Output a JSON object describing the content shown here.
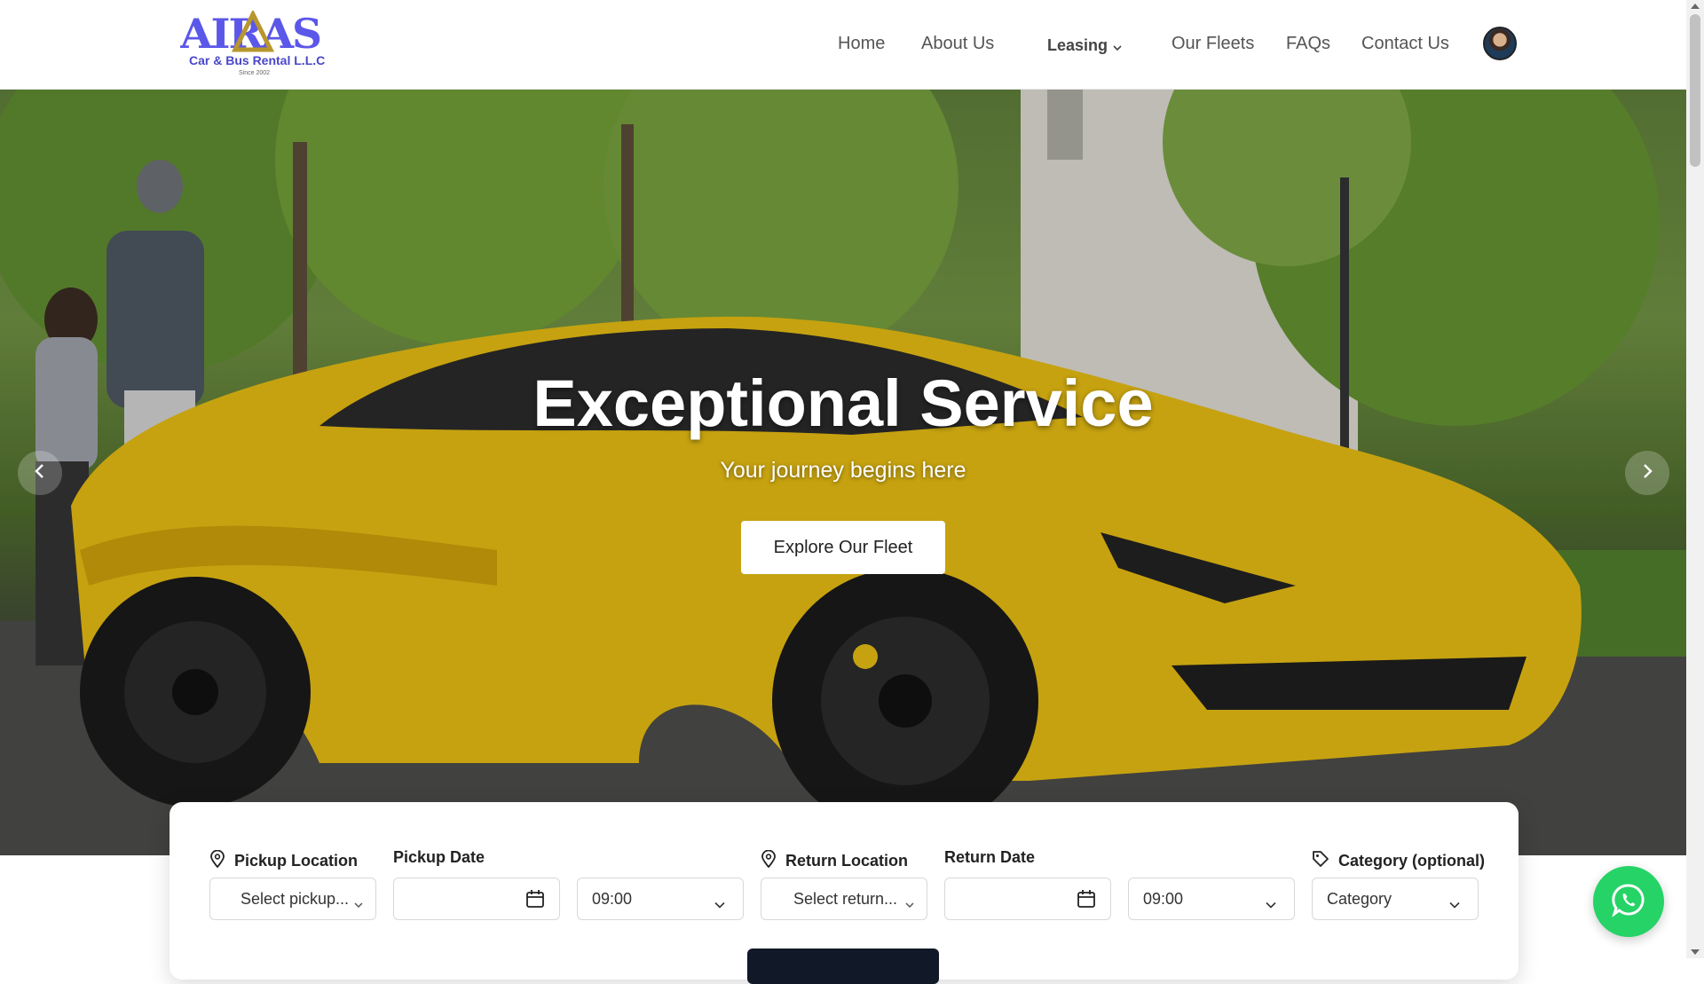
{
  "brand": {
    "name": "AIRAS",
    "tagline": "Car & Bus Rental  L.L.C",
    "since": "Since 2002"
  },
  "nav": {
    "home": "Home",
    "about": "About Us",
    "leasing": "Leasing",
    "fleets": "Our Fleets",
    "faqs": "FAQs",
    "contact": "Contact Us"
  },
  "hero": {
    "title": "Exceptional Service",
    "subtitle": "Your journey begins here",
    "cta": "Explore Our Fleet"
  },
  "booking": {
    "pickup_location_label": "Pickup Location",
    "pickup_location_value": "Select pickup...",
    "pickup_date_label": "Pickup Date",
    "pickup_time": "09:00",
    "return_location_label": "Return Location",
    "return_location_value": "Select return...",
    "return_date_label": "Return Date",
    "return_time": "09:00",
    "category_label": "Category (optional)",
    "category_value": "Category"
  },
  "icons": {
    "location": "map-pin-icon",
    "calendar": "calendar-icon",
    "tag": "tag-icon",
    "chevron": "chevron-down-icon",
    "prev": "chevron-left-icon",
    "next": "chevron-right-icon",
    "whatsapp": "whatsapp-icon"
  },
  "colors": {
    "brand": "#5b57e8",
    "brand_accent": "#b8962e",
    "car": "#e2b913",
    "whatsapp": "#25d366",
    "search_button": "#111827"
  }
}
